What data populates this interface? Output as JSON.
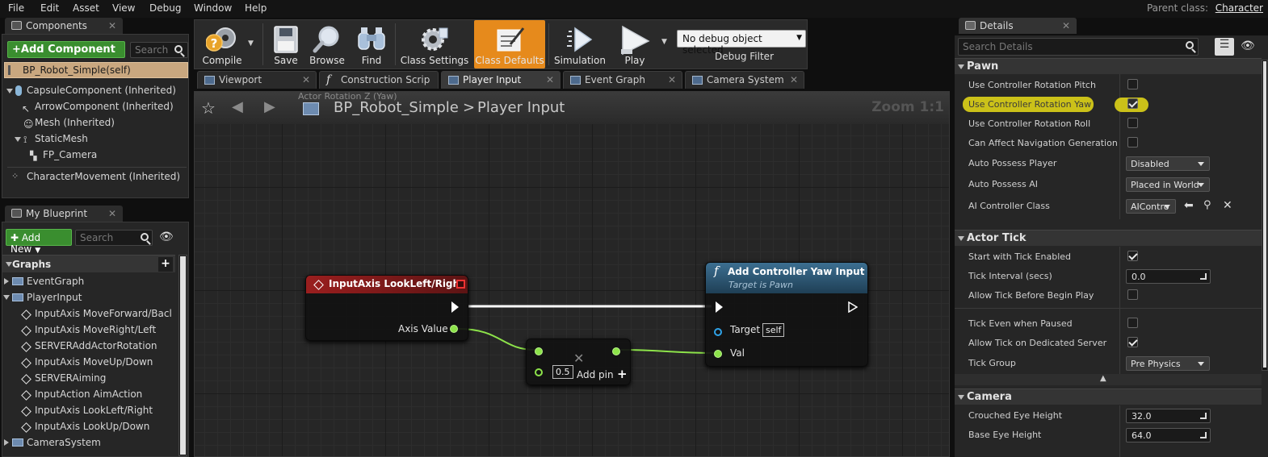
{
  "menu": [
    "File",
    "Edit",
    "Asset",
    "View",
    "Debug",
    "Window",
    "Help"
  ],
  "parent_class": {
    "label": "Parent class:",
    "value": "Character"
  },
  "components_panel": {
    "tab_label": "Components",
    "add_button": "+Add Component",
    "search_placeholder": "Search",
    "root": "BP_Robot_Simple(self)",
    "items": [
      "CapsuleComponent (Inherited)",
      "ArrowComponent (Inherited)",
      "Mesh (Inherited)",
      "StaticMesh",
      "FP_Camera",
      "CharacterMovement (Inherited)"
    ]
  },
  "my_blueprint": {
    "tab_label": "My Blueprint",
    "add_button": "Add New",
    "search_placeholder": "Search",
    "graphs_header": "Graphs",
    "items": [
      "EventGraph",
      "PlayerInput",
      "InputAxis MoveForward/Bacl",
      "InputAxis MoveRight/Left",
      "SERVERAddActorRotation",
      "InputAxis MoveUp/Down",
      "SERVERAiming",
      "InputAction AimAction",
      "InputAxis LookLeft/Right",
      "InputAxis LookUp/Down",
      "CameraSystem"
    ]
  },
  "toolbar": {
    "compile": "Compile",
    "save": "Save",
    "browse": "Browse",
    "find": "Find",
    "class_settings": "Class Settings",
    "class_defaults": "Class Defaults",
    "simulation": "Simulation",
    "play": "Play",
    "debug_select": "No debug object selected",
    "debug_filter": "Debug Filter"
  },
  "doc_tabs": [
    "Viewport",
    "Construction Scrip",
    "Player Input",
    "Event Graph",
    "Camera System"
  ],
  "graph": {
    "breadcrumb_bp": "BP_Robot_Simple",
    "breadcrumb_sep": ">",
    "breadcrumb_graph": "Player Input",
    "zoom": "Zoom 1:1",
    "ghost_text": "Actor Rotation Z (Yaw)",
    "node_input": {
      "title": "InputAxis LookLeft/Right",
      "pin_axis": "Axis Value"
    },
    "node_mult": {
      "value": "0.5",
      "add_pin": "Add pin"
    },
    "node_yaw": {
      "title": "Add Controller Yaw Input",
      "subtitle": "Target is Pawn",
      "pin_target": "Target",
      "target_value": "self",
      "pin_val": "Val"
    }
  },
  "details": {
    "tab_label": "Details",
    "search_placeholder": "Search Details",
    "pawn": {
      "header": "Pawn",
      "rows": [
        {
          "label": "Use Controller Rotation Pitch",
          "checked": false
        },
        {
          "label": "Use Controller Rotation Yaw",
          "checked": true
        },
        {
          "label": "Use Controller Rotation Roll",
          "checked": false
        },
        {
          "label": "Can Affect Navigation Generation",
          "checked": false
        }
      ],
      "auto_possess_player": {
        "label": "Auto Possess Player",
        "value": "Disabled"
      },
      "auto_possess_ai": {
        "label": "Auto Possess AI",
        "value": "Placed in World"
      },
      "ai_controller": {
        "label": "AI Controller Class",
        "value": "AIContro"
      }
    },
    "actor_tick": {
      "header": "Actor Tick",
      "start_tick": {
        "label": "Start with Tick Enabled",
        "checked": true
      },
      "tick_interval": {
        "label": "Tick Interval (secs)",
        "value": "0.0"
      },
      "allow_tick_before": {
        "label": "Allow Tick Before Begin Play",
        "checked": false
      },
      "tick_paused": {
        "label": "Tick Even when Paused",
        "checked": false
      },
      "tick_dedicated": {
        "label": "Allow Tick on Dedicated Server",
        "checked": true
      },
      "tick_group": {
        "label": "Tick Group",
        "value": "Pre Physics"
      }
    },
    "camera": {
      "header": "Camera",
      "crouched": {
        "label": "Crouched Eye Height",
        "value": "32.0"
      },
      "base": {
        "label": "Base Eye Height",
        "value": "64.0"
      }
    }
  },
  "colors": {
    "highlight": "#f0e61a",
    "accent_orange": "#e68a1c",
    "green_button": "#3a8e2f",
    "node_header_red": "#8a1c1c",
    "node_header_blue": "#2b5a7a",
    "float_pin": "#8de34a"
  }
}
